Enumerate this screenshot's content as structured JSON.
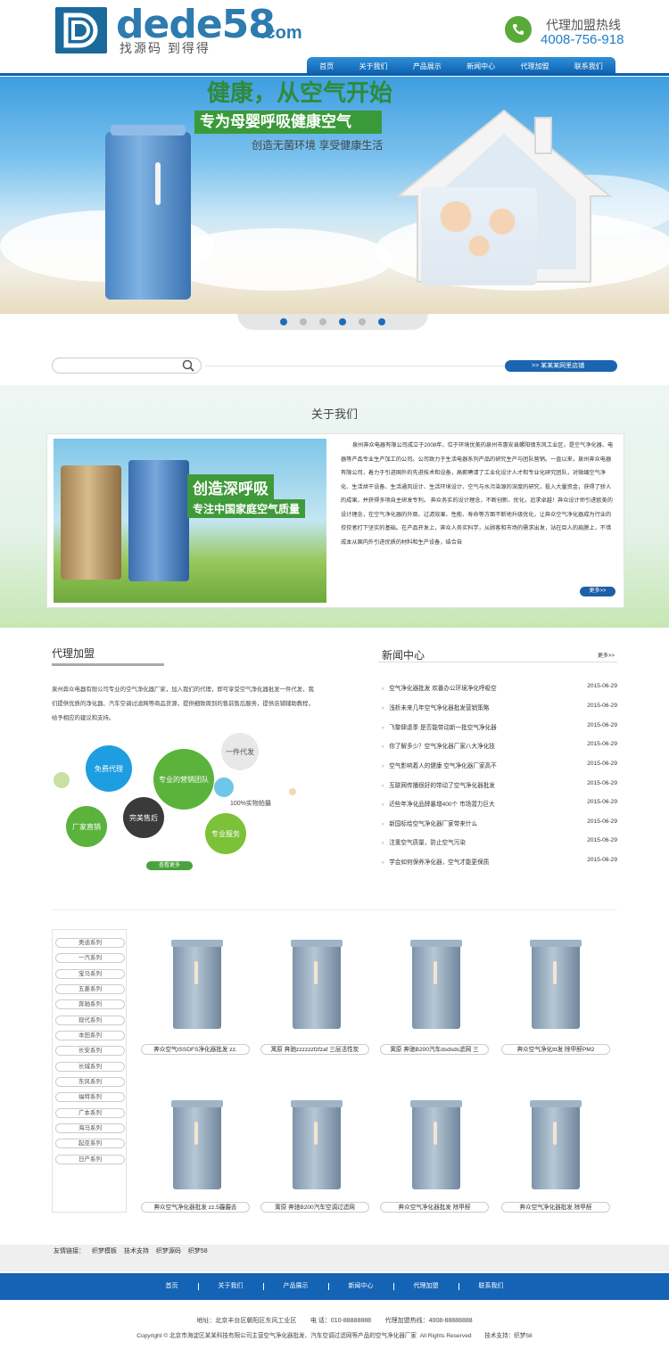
{
  "header": {
    "logo_text": "dede58",
    "logo_suffix": ".com",
    "logo_slogan": "找源码 到得得",
    "hotline_label": "代理加盟热线",
    "hotline_number": "4008-756-918"
  },
  "nav": [
    "首页",
    "关于我们",
    "产品展示",
    "新闻中心",
    "代理加盟",
    "联系我们"
  ],
  "banner": {
    "headline": "健康，从空气开始",
    "tagline": "专为母婴呼吸健康空气",
    "subline": "创造无菌环境 享受健康生活",
    "slide_count": 6,
    "active_slides": [
      0,
      3,
      5
    ]
  },
  "search": {
    "placeholder": "",
    "store_button": ">> 某某某网里店铺"
  },
  "about": {
    "title": "关于我们",
    "image_text1": "创造深呼吸",
    "image_text2": "专注中国家庭空气质量",
    "body": "泉州奔众电器有限公司成立于2008年，位于环境优美的泉州市惠安县螺阳镇东风工业区，是空气净化器、电器等产品专业生产加工的公司。公司致力于生活电器系列产品的研究生产与团队营销。一直以来，泉州奔众电器有限公司，着力于引进国外的先进技术和设备，高薪聘请了工业化设计人才和专业化研究团队，对微细空气净化、生活烘干设备、生活通风设计、生活环境设计、空气与水污染源的深度的研究，投入大量资金，获得了骄人的成果，并获得多项自主研发专利。 奔众务实的设计理念，不断创新、优化，追求卓越！奔众设计师引进欧美的设计理念，在空气净化器的外观、过滤效果、性能、寿命等方面不断地升级优化，让奔众空气净化器成为行业的佼佼者打下坚实的基础。在产品开发上，奔众人务实科学，从顾客和市场的需求出发，站在巨人的肩膀上，不惜成本从国内外引进优质的材料和生产设备，结合自",
    "more_button": "更多>>"
  },
  "join": {
    "title": "代理加盟",
    "body": "泉州奔众电器有限公司专业的空气净化器厂家，加入我们的代理，即可享受空气净化器批发一件代发，我们提供优质的净化器、汽车空调过滤网等商品货源，提供细致周到的售前售后服务，提供店铺辅助教程，给予相应的建议和支持。",
    "bubbles": [
      "免费代理",
      "专业的营销团队",
      "一件代发",
      "100%实物拍摄",
      "完美售后",
      "厂家直销",
      "专业服务"
    ],
    "view_more": "查看更多"
  },
  "news": {
    "title": "新闻中心",
    "more": "更多>>",
    "items": [
      {
        "title": "空气净化器批发 欢番办公环境净化呼吸空",
        "date": "2015-06-29"
      },
      {
        "title": "浅析未来几年空气净化器批发营销策略",
        "date": "2015-06-29"
      },
      {
        "title": "飞黎肆虐季 是否能带动新一批空气净化器",
        "date": "2015-06-29"
      },
      {
        "title": "你了解多少？空气净化器厂家八大净化技",
        "date": "2015-06-29"
      },
      {
        "title": "空气影响着人的健康 空气净化器厂家高不",
        "date": "2015-06-29"
      },
      {
        "title": "互联网传播很好的带动了空气净化器批发",
        "date": "2015-06-29"
      },
      {
        "title": "近些年净化品牌暴增400个 市场潜力巨大",
        "date": "2015-06-29"
      },
      {
        "title": "新国标给空气净化器厂家带来什么",
        "date": "2015-06-29"
      },
      {
        "title": "注重空气质量，防止空气污染",
        "date": "2015-06-29"
      },
      {
        "title": "学会如何保养净化器，空气才能更保质",
        "date": "2015-06-29"
      }
    ]
  },
  "categories": [
    "奥迪系列",
    "一汽系列",
    "宝马系列",
    "五菱系列",
    "奔驰系列",
    "现代系列",
    "本田系列",
    "长安系列",
    "长城系列",
    "东风系列",
    "福特系列",
    "广本系列",
    "海马系列",
    "起亚系列",
    "日产系列"
  ],
  "products": [
    "奔众空气tSSDFS净化器批发 zz.",
    "寓原 奔驰zzzzzzfzfzaf 三层活性炭",
    "寓原 奔驰B200汽车dsdsds滤网 三",
    "奔众空气净化ttt发 除甲醛PM2",
    "奔众空气净化器批发 zz.5霾霾去",
    "寓原 奔驰B200汽车空调过滤网",
    "奔众空气净化器批发 除甲醛",
    "奔众空气净化器批发 除甲醛"
  ],
  "footer": {
    "links_label": "友情链接：",
    "links": [
      "织梦模板",
      "技术支持",
      "织梦源码",
      "织梦58"
    ],
    "nav": [
      "首页",
      "关于我们",
      "产品展示",
      "新闻中心",
      "代理加盟",
      "联系我们"
    ],
    "address": "地址：北京丰台区朝阳区东风工业区        电 话：010-88888888        代理加盟热线：4008-88888888",
    "copyright": "Copyright © 北京市海淀区某某科技有限公司主营空气净化器批发、汽车空调过滤网等产品的空气净化器厂家  All Rights Reserved        技术支持：织梦58"
  },
  "colors": {
    "brand_blue": "#1563b5",
    "accent_green": "#4aa33e"
  }
}
